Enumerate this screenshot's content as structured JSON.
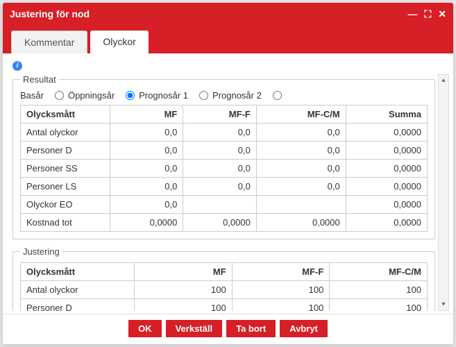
{
  "window": {
    "title": "Justering för nod"
  },
  "tabs": {
    "kommentar": "Kommentar",
    "olyckor": "Olyckor",
    "active": "olyckor"
  },
  "radios": {
    "basar": "Basår",
    "oppningsar": "Öppningsår",
    "prognos1": "Prognosår 1",
    "prognos2": "Prognosår 2",
    "selected": "oppningsar"
  },
  "resultat": {
    "legend": "Resultat",
    "headers": {
      "col1": "Olycksmått",
      "col2": "MF",
      "col3": "MF-F",
      "col4": "MF-C/M",
      "col5": "Summa"
    },
    "rows": [
      {
        "label": "Antal olyckor",
        "mf": "0,0",
        "mff": "0,0",
        "mfcm": "0,0",
        "summa": "0,0000"
      },
      {
        "label": "Personer D",
        "mf": "0,0",
        "mff": "0,0",
        "mfcm": "0,0",
        "summa": "0,0000"
      },
      {
        "label": "Personer SS",
        "mf": "0,0",
        "mff": "0,0",
        "mfcm": "0,0",
        "summa": "0,0000"
      },
      {
        "label": "Personer LS",
        "mf": "0,0",
        "mff": "0,0",
        "mfcm": "0,0",
        "summa": "0,0000"
      },
      {
        "label": "Olyckor EO",
        "mf": "0,0",
        "mff": "",
        "mfcm": "",
        "summa": "0,0000"
      },
      {
        "label": "Kostnad tot",
        "mf": "0,0000",
        "mff": "0,0000",
        "mfcm": "0,0000",
        "summa": "0,0000"
      }
    ]
  },
  "justering": {
    "legend": "Justering",
    "headers": {
      "col1": "Olycksmått",
      "col2": "MF",
      "col3": "MF-F",
      "col4": "MF-C/M"
    },
    "rows": [
      {
        "label": "Antal olyckor",
        "mf": "100",
        "mff": "100",
        "mfcm": "100"
      },
      {
        "label": "Personer D",
        "mf": "100",
        "mff": "100",
        "mfcm": "100"
      }
    ]
  },
  "buttons": {
    "ok": "OK",
    "verkstall": "Verkställ",
    "tabort": "Ta bort",
    "avbryt": "Avbryt"
  }
}
